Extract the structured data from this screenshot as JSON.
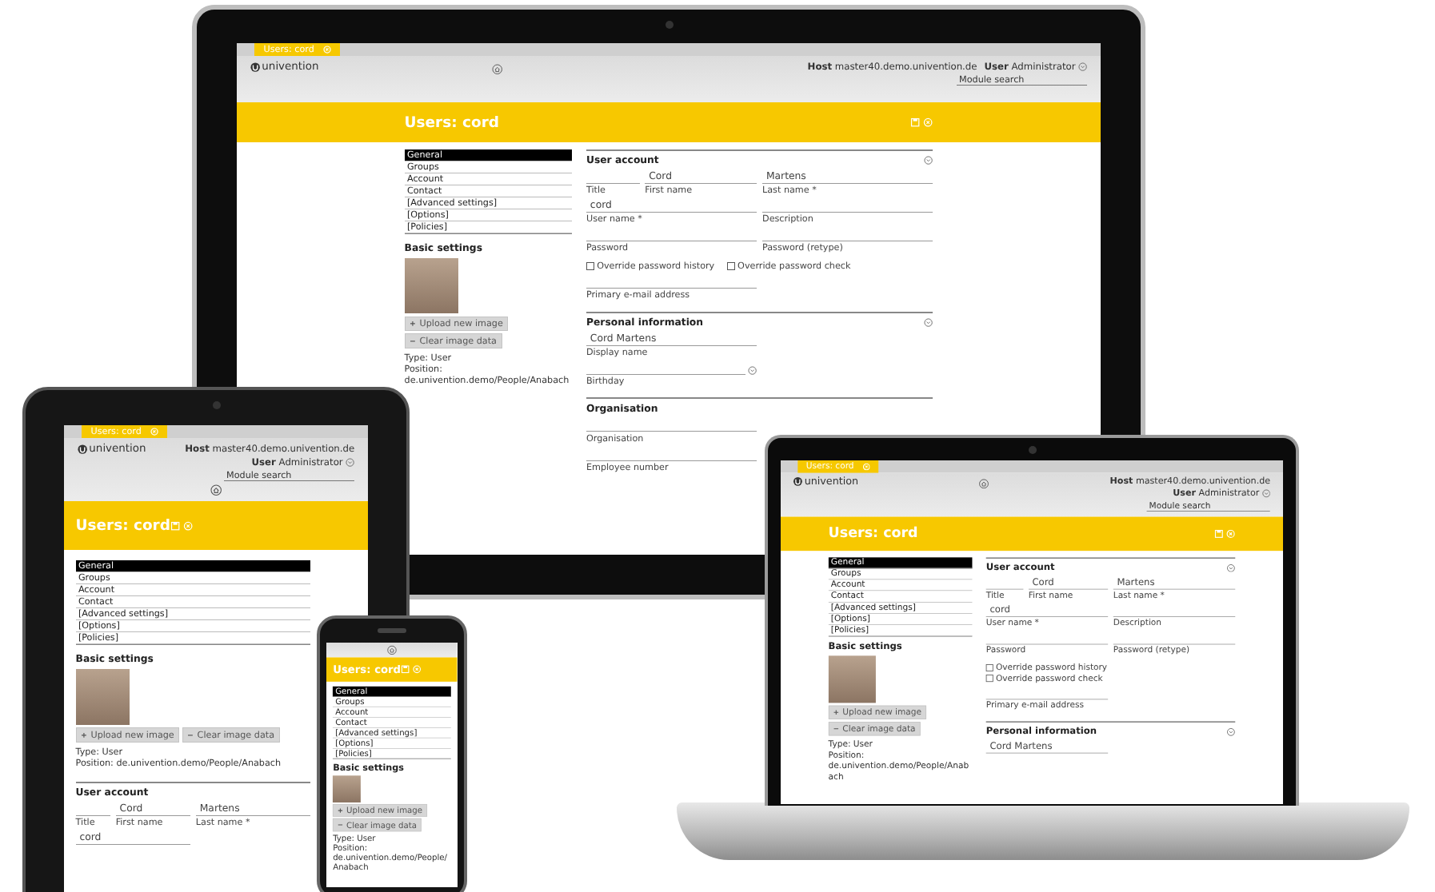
{
  "devices": [
    {
      "kind": "monitor",
      "tab": {
        "label": "Users: cord"
      },
      "header": {
        "logo": "univention",
        "host": "**Host** master40.demo.univention.de",
        "user": "**User** Administrator",
        "search": {
          "placeholder": "Module search"
        }
      },
      "title": "Users: cord",
      "nav": [
        {
          "label": "General",
          "selected": true
        },
        {
          "label": "Groups",
          "selected": false
        },
        {
          "label": "Account",
          "selected": false
        },
        {
          "label": "Contact",
          "selected": false
        },
        {
          "label": "[Advanced settings]",
          "selected": false
        },
        {
          "label": "[Options]",
          "selected": false
        },
        {
          "label": "[Policies]",
          "selected": false
        }
      ],
      "basic_settings": {
        "title": "Basic settings",
        "buttons": [
          "Upload new image",
          "Clear image data"
        ],
        "type": "Type: User",
        "position": "Position: de.univention.demo/People/Anabach"
      },
      "sections": [
        {
          "title": "User account",
          "collapsible": true,
          "rows": [
            {
              "kind": "fields",
              "fields": [
                {
                  "kind": "text",
                  "label": "Title"
                },
                {
                  "kind": "text",
                  "label": "First name",
                  "value": "Cord"
                },
                {
                  "kind": "text",
                  "label": "Last name *",
                  "value": "Martens"
                }
              ]
            },
            {
              "kind": "fields",
              "fields": [
                {
                  "kind": "text",
                  "label": "User name *",
                  "value": "cord"
                },
                {
                  "kind": "text",
                  "label": "Description"
                }
              ]
            },
            {
              "kind": "fields",
              "fields": [
                {
                  "kind": "text",
                  "label": "Password"
                },
                {
                  "kind": "text",
                  "label": "Password (retype)"
                }
              ]
            },
            {
              "kind": "checks",
              "checks": [
                {
                  "label": "Override password history",
                  "checked": false
                },
                {
                  "label": "Override password check",
                  "checked": false
                }
              ]
            },
            {
              "kind": "fields",
              "fields": [
                {
                  "kind": "text",
                  "label": "Primary e-mail address"
                }
              ]
            }
          ]
        },
        {
          "title": "Personal information",
          "collapsible": true,
          "rows": [
            {
              "kind": "fields",
              "fields": [
                {
                  "kind": "text",
                  "label": "Display name",
                  "value": "Cord Martens"
                }
              ]
            },
            {
              "kind": "fields",
              "fields": [
                {
                  "kind": "date",
                  "label": "Birthday"
                }
              ]
            }
          ]
        },
        {
          "title": "Organisation",
          "collapsible": false,
          "rows": [
            {
              "kind": "fields",
              "fields": [
                {
                  "kind": "text",
                  "label": "Organisation"
                }
              ]
            },
            {
              "kind": "fields",
              "fields": [
                {
                  "kind": "text",
                  "label": "Employee number"
                }
              ]
            }
          ]
        }
      ]
    },
    {
      "kind": "tablet",
      "tab": {
        "label": "Users: cord"
      },
      "header": {
        "logo": "univention",
        "host": "**Host** master40.demo.univention.de",
        "user": "**User** Administrator",
        "search": {
          "placeholder": "Module search"
        }
      },
      "title": "Users: cord",
      "nav": [
        {
          "label": "General",
          "selected": true
        },
        {
          "label": "Groups",
          "selected": false
        },
        {
          "label": "Account",
          "selected": false
        },
        {
          "label": "Contact",
          "selected": false
        },
        {
          "label": "[Advanced settings]",
          "selected": false
        },
        {
          "label": "[Options]",
          "selected": false
        },
        {
          "label": "[Policies]",
          "selected": false
        }
      ],
      "basic_settings": {
        "title": "Basic settings",
        "buttons": [
          "Upload new image",
          "Clear image data"
        ],
        "type": "Type: User",
        "position": "Position: de.univention.demo/People/Anabach"
      },
      "sections": [
        {
          "title": "User account",
          "collapsible": false,
          "rows": [
            {
              "kind": "fields",
              "fields": [
                {
                  "kind": "text",
                  "label": "Title"
                },
                {
                  "kind": "text",
                  "label": "First name",
                  "value": "Cord"
                },
                {
                  "kind": "text",
                  "label": "Last name *",
                  "value": "Martens"
                }
              ]
            },
            {
              "kind": "fields",
              "fields": [
                {
                  "kind": "text",
                  "value": "cord"
                }
              ]
            }
          ]
        }
      ]
    },
    {
      "kind": "phone",
      "title": "Users: cord",
      "nav": [
        {
          "label": "General",
          "selected": true
        },
        {
          "label": "Groups",
          "selected": false
        },
        {
          "label": "Account",
          "selected": false
        },
        {
          "label": "Contact",
          "selected": false
        },
        {
          "label": "[Advanced settings]",
          "selected": false
        },
        {
          "label": "[Options]",
          "selected": false
        },
        {
          "label": "[Policies]",
          "selected": false
        }
      ],
      "basic_settings": {
        "title": "Basic settings",
        "buttons": [
          "Upload new image",
          "Clear image data"
        ],
        "type": "Type: User",
        "position": "Position: de.univention.demo/People/Anabach"
      }
    },
    {
      "kind": "laptop",
      "tab": {
        "label": "Users: cord"
      },
      "header": {
        "logo": "univention",
        "host": "**Host** master40.demo.univention.de",
        "user": "**User** Administrator",
        "search": {
          "placeholder": "Module search"
        }
      },
      "title": "Users: cord",
      "nav": [
        {
          "label": "General",
          "selected": true
        },
        {
          "label": "Groups",
          "selected": false
        },
        {
          "label": "Account",
          "selected": false
        },
        {
          "label": "Contact",
          "selected": false
        },
        {
          "label": "[Advanced settings]",
          "selected": false
        },
        {
          "label": "[Options]",
          "selected": false
        },
        {
          "label": "[Policies]",
          "selected": false
        }
      ],
      "basic_settings": {
        "title": "Basic settings",
        "buttons": [
          "Upload new image",
          "Clear image data"
        ],
        "type": "Type: User",
        "position": "Position: de.univention.demo/People/Anabach"
      },
      "sections": [
        {
          "title": "User account",
          "collapsible": true,
          "rows": [
            {
              "kind": "fields",
              "fields": [
                {
                  "kind": "text",
                  "label": "Title"
                },
                {
                  "kind": "text",
                  "label": "First name",
                  "value": "Cord"
                },
                {
                  "kind": "text",
                  "label": "Last name *",
                  "value": "Martens"
                }
              ]
            },
            {
              "kind": "fields",
              "fields": [
                {
                  "kind": "text",
                  "label": "User name *",
                  "value": "cord"
                },
                {
                  "kind": "text",
                  "label": "Description"
                }
              ]
            },
            {
              "kind": "fields",
              "fields": [
                {
                  "kind": "text",
                  "label": "Password"
                },
                {
                  "kind": "text",
                  "label": "Password (retype)"
                }
              ]
            },
            {
              "kind": "checks",
              "checks": [
                {
                  "label": "Override password history",
                  "checked": false
                },
                {
                  "label": "Override password check",
                  "checked": false
                }
              ]
            },
            {
              "kind": "fields",
              "fields": [
                {
                  "kind": "text",
                  "label": "Primary e-mail address"
                }
              ]
            }
          ]
        },
        {
          "title": "Personal information",
          "collapsible": true,
          "rows": [
            {
              "kind": "fields",
              "fields": [
                {
                  "kind": "text",
                  "value": "Cord Martens"
                }
              ]
            }
          ]
        }
      ]
    }
  ]
}
